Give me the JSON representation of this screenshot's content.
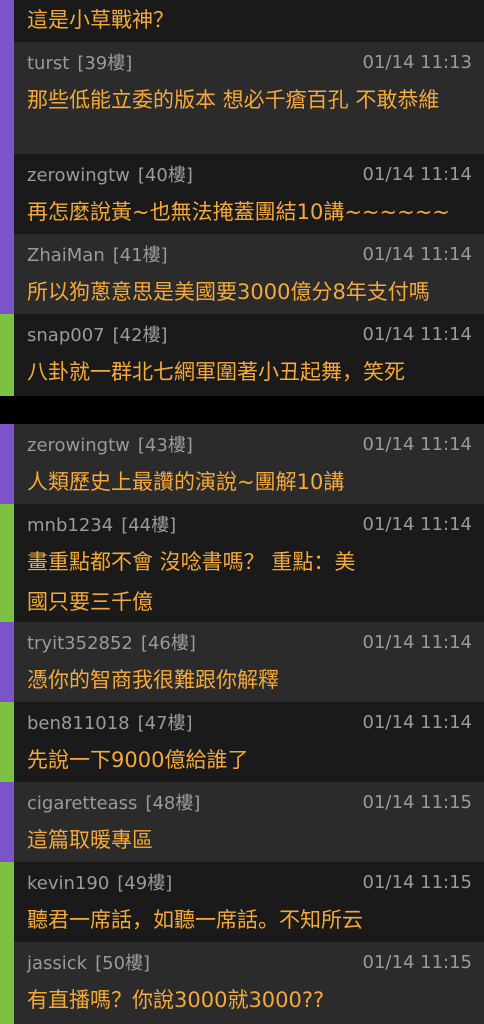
{
  "accent_colors": {
    "purple": "#7b55c9",
    "green": "#7cc242",
    "text": "#f5a93a",
    "meta": "#9a9a9a",
    "row_dark": "#1a1a1a",
    "row_mid": "#2b2b2b"
  },
  "posts": [
    {
      "user": "",
      "floor": "",
      "time": "",
      "text": "這是小草戰神？"
    },
    {
      "user": "turst",
      "floor": "[39樓]",
      "time": "01/14 11:13",
      "text": "那些低能立委的版本  想必千瘡百孔  不敢恭維"
    },
    {
      "user": "zerowingtw",
      "floor": "[40樓]",
      "time": "01/14 11:14",
      "text": "再怎麼說黃~也無法掩蓋團結10講~~~~~~"
    },
    {
      "user": "ZhaiMan",
      "floor": "[41樓]",
      "time": "01/14 11:14",
      "text": "所以狗蔥意思是美國要3000億分8年支付嗎"
    },
    {
      "user": "snap007",
      "floor": "[42樓]",
      "time": "01/14 11:14",
      "text": "八卦就一群北七網軍圍著小丑起舞，笑死"
    },
    {
      "user": "zerowingtw",
      "floor": "[43樓]",
      "time": "01/14 11:14",
      "text": "人類歷史上最讚的演說~團解10講"
    },
    {
      "user": "mnb1234",
      "floor": "[44樓]",
      "time": "01/14 11:14",
      "text": "畫重點都不會  沒唸書嗎？  重點：美",
      "text2": "國只要三千億"
    },
    {
      "user": "tryit352852",
      "floor": "[46樓]",
      "time": "01/14 11:14",
      "text": "憑你的智商我很難跟你解釋"
    },
    {
      "user": "ben811018",
      "floor": "[47樓]",
      "time": "01/14 11:14",
      "text": "先說一下9000億給誰了"
    },
    {
      "user": "cigaretteass",
      "floor": "[48樓]",
      "time": "01/14 11:15",
      "text": "這篇取暖專區"
    },
    {
      "user": "kevin190",
      "floor": "[49樓]",
      "time": "01/14 11:15",
      "text": "聽君一席話，如聽一席話。不知所云"
    },
    {
      "user": "jassick",
      "floor": "[50樓]",
      "time": "01/14 11:15",
      "text": "有直播嗎？你說3000就3000??"
    }
  ]
}
